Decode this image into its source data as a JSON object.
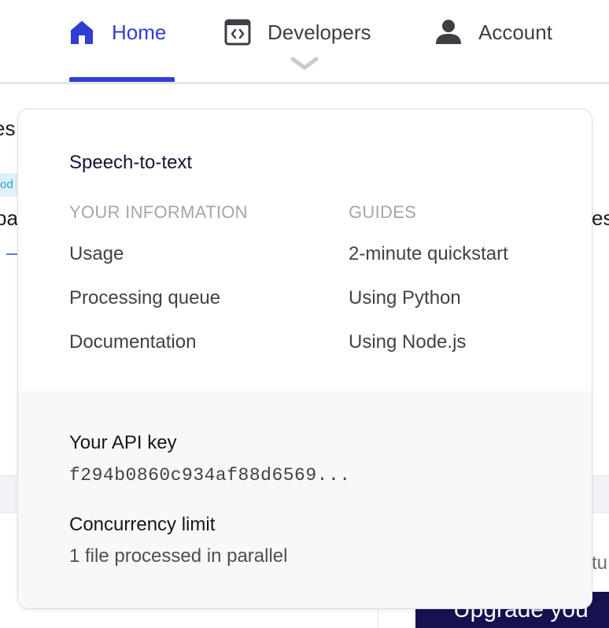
{
  "nav": {
    "items": [
      {
        "label": "Home",
        "icon": "home-icon",
        "active": true
      },
      {
        "label": "Developers",
        "icon": "code-window-icon",
        "active": false
      },
      {
        "label": "Account",
        "icon": "user-icon",
        "active": false
      }
    ],
    "active_color": "#2f3dd4"
  },
  "background": {
    "fragment_1": "es",
    "fragment_2": "pa",
    "fragment_3": "es",
    "tag_fragment": "od",
    "fragment_4": "tu",
    "upgrade_fragment": "Upgrade you"
  },
  "dropdown": {
    "title": "Speech-to-text",
    "your_information": {
      "heading": "YOUR INFORMATION",
      "links": [
        "Usage",
        "Processing queue",
        "Documentation"
      ]
    },
    "guides": {
      "heading": "GUIDES",
      "links": [
        "2-minute quickstart",
        "Using Python",
        "Using Node.js"
      ]
    },
    "footer": {
      "api_key_label": "Your API key",
      "api_key_value": "f294b0860c934af88d6569...",
      "concurrency_label": "Concurrency limit",
      "concurrency_value": "1 file processed in parallel"
    }
  }
}
